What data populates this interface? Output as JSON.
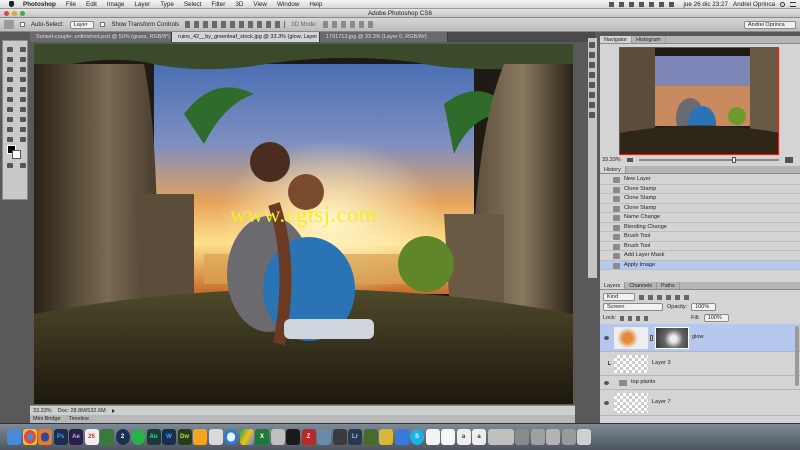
{
  "menubar": {
    "app": "Photoshop",
    "items": [
      "File",
      "Edit",
      "Image",
      "Layer",
      "Type",
      "Select",
      "Filter",
      "3D",
      "View",
      "Window",
      "Help"
    ],
    "status": {
      "datetime": "jue 26 dic  23:27",
      "user": "Andrei Oprinca"
    }
  },
  "window": {
    "title": "Adobe Photoshop CS6"
  },
  "options_bar": {
    "auto_select_label": "Auto-Select:",
    "auto_select_value": "Layer",
    "show_transform_label": "Show Transform Controls",
    "mode_3d_label": "3D Mode:",
    "workspace_value": "Andrei Oprinca"
  },
  "document_tabs": [
    "Sunset-couple- unfinished.psd @ 50% (grass, RGB/8*)",
    "ruins_42__by_greenleaf_stock.jpg @ 33.3% (glow, Layer Mask/8)",
    "1791713.jpg @ 33.3% (Layer 0, RGB/8#)"
  ],
  "canvas": {
    "watermark": "www.cgtsj.com"
  },
  "status_bar": {
    "zoom": "33.33%",
    "doc_info": "Doc: 28.8M/532.6M",
    "mini_bridge": "Mini Bridge",
    "timeline": "Timeline"
  },
  "navigator": {
    "tabs": [
      "Navigator",
      "Histogram"
    ],
    "zoom": "33.33%"
  },
  "history": {
    "tab": "History",
    "items": [
      "New Layer",
      "Clone Stamp",
      "Clone Stamp",
      "Clone Stamp",
      "Name Change",
      "Blending Change",
      "Brush Tool",
      "Brush Tool",
      "Add Layer Mask",
      "Apply Image"
    ],
    "selected_index": 9
  },
  "layers_panel": {
    "tabs": [
      "Layers",
      "Channels",
      "Paths"
    ],
    "filter_label": "Kind",
    "blend_mode": "Screen",
    "opacity_label": "Opacity:",
    "opacity_value": "100%",
    "lock_label": "Lock:",
    "fill_label": "Fill:",
    "fill_value": "100%",
    "layers": [
      {
        "name": "glow",
        "selected": true
      },
      {
        "name": "Layer 3",
        "selected": false
      },
      {
        "name": "top plants",
        "selected": false,
        "group": true
      },
      {
        "name": "Layer 7",
        "selected": false
      }
    ]
  },
  "dock": {
    "apps": [
      "Finder",
      "Chrome",
      "Firefox",
      "Photoshop",
      "After Effects",
      "Calendar",
      "Sims",
      "Steam",
      "Spotify",
      "Audition",
      "Lightroom",
      "Dreamweaver",
      "VLC",
      "Sketch",
      "Safari",
      "Drive",
      "Excel",
      "Activity",
      "Terminal",
      "FileZilla",
      "Preview",
      "Vector",
      "Lightroom",
      "Photos",
      "Downloads",
      "Xcode",
      "Skype",
      "Stickies",
      "TextEdit",
      "Font",
      "Notes",
      "Trash"
    ]
  },
  "colors": {
    "history_selected": "#b4c9ee",
    "layer_selected": "#b6c8ee",
    "watermark": "#f2ef27"
  }
}
